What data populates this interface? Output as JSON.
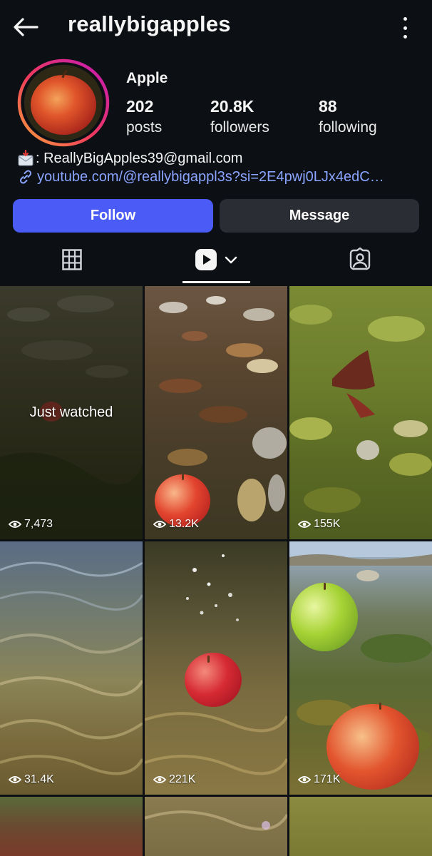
{
  "header": {
    "username": "reallybigapples",
    "back_icon": "arrow-left-icon",
    "menu_icon": "kebab-menu-icon"
  },
  "profile": {
    "display_name": "Apple",
    "posts_count": "202",
    "posts_label": "posts",
    "followers_count": "20.8K",
    "followers_label": "followers",
    "following_count": "88",
    "following_label": "following",
    "email_line": ": ReallyBigApples39@gmail.com",
    "link": "youtube.com/@reallybigappl3s?si=2E4pwj0LJx4edC…"
  },
  "actions": {
    "follow_label": "Follow",
    "message_label": "Message"
  },
  "tabs": {
    "items": [
      "grid-icon",
      "reels-icon",
      "tagged-icon"
    ],
    "active": "reels"
  },
  "grid": {
    "tiles": [
      {
        "views": "7,473",
        "overlay": "Just watched"
      },
      {
        "views": "13.2K"
      },
      {
        "views": "155K"
      },
      {
        "views": "31.4K"
      },
      {
        "views": "221K"
      },
      {
        "views": "171K"
      }
    ]
  },
  "colors": {
    "background": "#0c0f14",
    "follow_button": "#4a5cf5",
    "message_button": "#2a2d33",
    "link": "#8aa4ff"
  }
}
